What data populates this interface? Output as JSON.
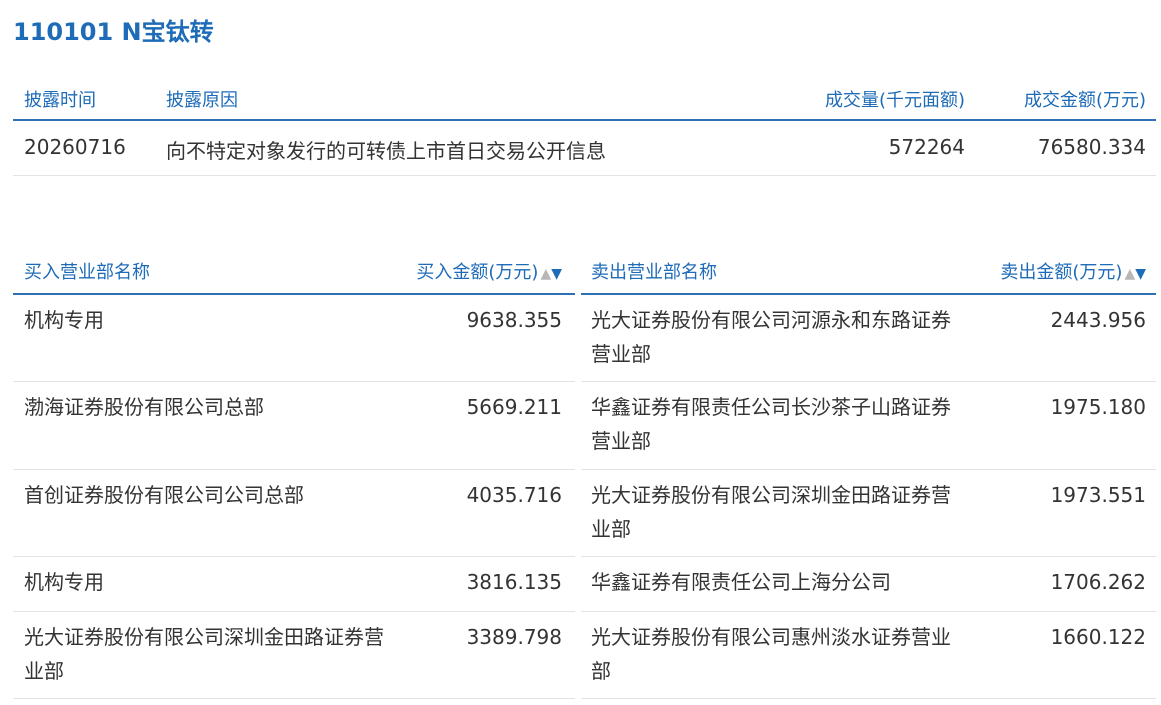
{
  "title": "110101 N宝钛转",
  "disclosure": {
    "headers": {
      "date": "披露时间",
      "reason": "披露原因",
      "volume": "成交量(千元面额)",
      "amount": "成交金额(万元)"
    },
    "row": {
      "date": "20260716",
      "reason": "向不特定对象发行的可转债上市首日交易公开信息",
      "volume": "572264",
      "amount": "76580.334"
    }
  },
  "buy": {
    "header_name": "买入营业部名称",
    "header_amount": "买入金额(万元)",
    "rows": [
      {
        "name": "机构专用",
        "amount": "9638.355"
      },
      {
        "name": "渤海证券股份有限公司总部",
        "amount": "5669.211"
      },
      {
        "name": "首创证券股份有限公司公司总部",
        "amount": "4035.716"
      },
      {
        "name": "机构专用",
        "amount": "3816.135"
      },
      {
        "name": "光大证券股份有限公司深圳金田路证券营业部",
        "amount": "3389.798"
      }
    ]
  },
  "sell": {
    "header_name": "卖出营业部名称",
    "header_amount": "卖出金额(万元)",
    "rows": [
      {
        "name": "光大证券股份有限公司河源永和东路证券营业部",
        "amount": "2443.956"
      },
      {
        "name": "华鑫证券有限责任公司长沙茶子山路证券营业部",
        "amount": "1975.180"
      },
      {
        "name": "光大证券股份有限公司深圳金田路证券营业部",
        "amount": "1973.551"
      },
      {
        "name": "华鑫证券有限责任公司上海分公司",
        "amount": "1706.262"
      },
      {
        "name": "光大证券股份有限公司惠州淡水证券营业部",
        "amount": "1660.122"
      }
    ]
  },
  "sort_icon": {
    "up": "▲",
    "down": "▼"
  },
  "colors": {
    "accent": "#1e6bb8",
    "text": "#333333",
    "divider": "#e3e3e3"
  }
}
